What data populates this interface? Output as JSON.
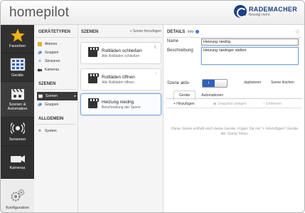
{
  "header": {
    "app_title": "homepilot",
    "brand_name": "RADEMACHER",
    "brand_tagline": "Bewegt mehr."
  },
  "nav": {
    "items": [
      {
        "label": "Favoriten",
        "icon": "star-icon"
      },
      {
        "label": "Geräte",
        "icon": "devices-icon"
      },
      {
        "label": "Szenen & Automation",
        "icon": "clapperboard-icon"
      },
      {
        "label": "Sensoren",
        "icon": "sensor-icon"
      },
      {
        "label": "Kameras",
        "icon": "camera-icon"
      }
    ],
    "bottom_label": "Konfiguration",
    "bottom_icon": "gear-icon"
  },
  "categories": {
    "sections": [
      {
        "title": "GERÄTETYPEN",
        "items": [
          "Aktoren",
          "Gruppen",
          "Sensoren",
          "Kameras"
        ]
      },
      {
        "title": "SZENEN",
        "items": [
          "Szenen",
          "Gruppen"
        ]
      },
      {
        "title": "ALLGEMEIN",
        "items": [
          "System"
        ]
      }
    ],
    "active_item": "Szenen"
  },
  "scenes": {
    "title": "SZENEN",
    "add_label": "+ Szene hinzufügen",
    "items": [
      {
        "name": "Rollläden schließen",
        "sub": "Alle Rollläden schließen",
        "badge": "☾"
      },
      {
        "name": "Rollläden öffnen",
        "sub": "Alle Rollläden öffnen",
        "badge": "☼"
      },
      {
        "name": "Heizung niedrig",
        "sub": "Beschreibung der Szene",
        "badge": ""
      }
    ]
  },
  "details": {
    "title": "DETAILS",
    "info_label": "Info",
    "name_label": "Name",
    "name_value": "Heizung niedrig",
    "desc_label": "Beschreibung",
    "desc_value": "Heizung niedriger stellen",
    "active_label": "Szene aktiv",
    "toggle_value": "I",
    "duplicate_label": "duplizieren",
    "delete_label": "Szene löschen",
    "tabs": [
      "Geräte",
      "Automationen"
    ],
    "toolbar": {
      "add": "+ Hinzufügen",
      "snapshot": "Snapshot anlegen",
      "remove": "− Entfernen"
    },
    "empty_message": "Diese Szene enthält noch keine Geräte. Fügen Sie mit \"+ Hinzufügen\" Geräte der Szene hinzu."
  },
  "colors": {
    "nav_bg": "#303030",
    "accent": "#2f62b8",
    "brand": "#1c3f86",
    "star": "#f2b21b"
  }
}
